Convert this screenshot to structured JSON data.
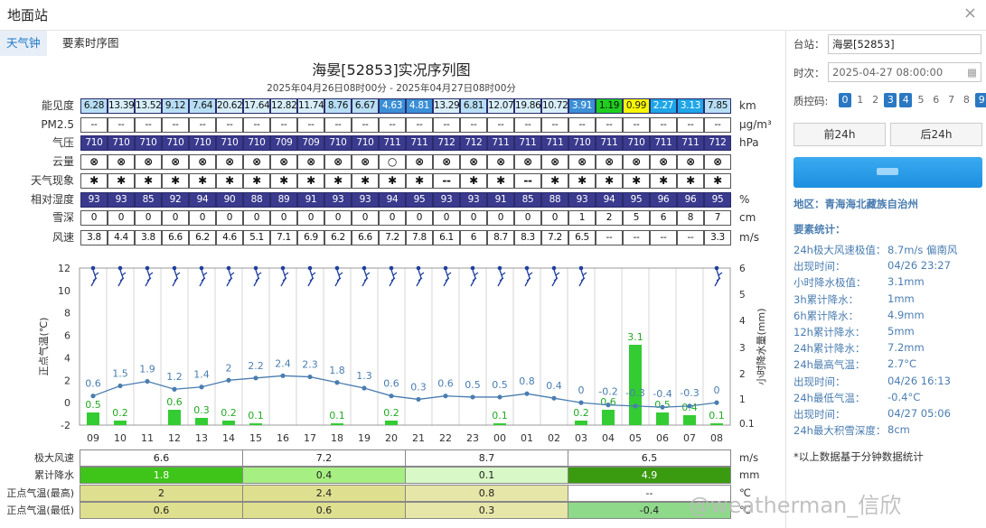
{
  "window": {
    "title": "地面站",
    "close": "×"
  },
  "tabs": [
    {
      "label": "天气钟",
      "active": true
    },
    {
      "label": "要素时序图",
      "active": false
    }
  ],
  "chart_title": "海晏[52853]实况序列图",
  "chart_subtitle": "2025年04月26日08时00分 - 2025年04月27日08时00分",
  "table": {
    "rows": [
      {
        "label": "能见度",
        "unit": "km",
        "type": "vis",
        "values": [
          "6.28",
          "13.39",
          "13.52",
          "9.12",
          "7.64",
          "20.62",
          "17.64",
          "12.82",
          "11.74",
          "8.76",
          "6.67",
          "4.63",
          "4.81",
          "13.29",
          "6.81",
          "12.07",
          "19.86",
          "10.72",
          "3.91",
          "1.19",
          "0.99",
          "2.27",
          "3.13",
          "7.85"
        ]
      },
      {
        "label": "PM2.5",
        "unit": "μg/m³",
        "type": "plain",
        "values": [
          "--",
          "--",
          "--",
          "--",
          "--",
          "--",
          "--",
          "--",
          "--",
          "--",
          "--",
          "--",
          "--",
          "--",
          "--",
          "--",
          "--",
          "--",
          "--",
          "--",
          "--",
          "--",
          "--",
          "--"
        ]
      },
      {
        "label": "气压",
        "unit": "hPa",
        "type": "dark",
        "values": [
          "710",
          "710",
          "710",
          "710",
          "710",
          "710",
          "710",
          "709",
          "709",
          "710",
          "710",
          "711",
          "711",
          "712",
          "712",
          "711",
          "711",
          "711",
          "710",
          "711",
          "710",
          "711",
          "711",
          "712"
        ]
      },
      {
        "label": "云量",
        "unit": "",
        "type": "wx",
        "values": [
          "⊗",
          "⊗",
          "⊗",
          "⊗",
          "⊗",
          "⊗",
          "⊗",
          "⊗",
          "⊗",
          "⊗",
          "⊗",
          "○",
          "⊗",
          "⊗",
          "⊗",
          "⊗",
          "⊗",
          "⊗",
          "⊗",
          "⊗",
          "⊗",
          "⊗",
          "⊗",
          "⊗"
        ]
      },
      {
        "label": "天气现象",
        "unit": "",
        "type": "wx",
        "values": [
          "✱",
          "✱",
          "✱",
          "✱",
          "✱",
          "✱",
          "✱",
          "✱",
          "✱",
          "✱",
          "✱",
          "✱",
          "✱",
          "--",
          "✱",
          "✱",
          "--",
          "✱",
          "✱",
          "✱",
          "✱",
          "✱",
          "✱",
          "✱"
        ]
      },
      {
        "label": "相对湿度",
        "unit": "%",
        "type": "dark",
        "values": [
          "93",
          "93",
          "85",
          "92",
          "94",
          "90",
          "88",
          "89",
          "91",
          "93",
          "93",
          "94",
          "95",
          "93",
          "93",
          "91",
          "85",
          "88",
          "93",
          "94",
          "95",
          "96",
          "96",
          "95"
        ]
      },
      {
        "label": "雪深",
        "unit": "cm",
        "type": "plain",
        "values": [
          "0",
          "0",
          "0",
          "0",
          "0",
          "0",
          "0",
          "0",
          "0",
          "0",
          "0",
          "0",
          "0",
          "0",
          "0",
          "0",
          "0",
          "0",
          "1",
          "2",
          "5",
          "6",
          "8",
          "7"
        ]
      },
      {
        "label": "风速",
        "unit": "m/s",
        "type": "plain",
        "values": [
          "3.8",
          "4.4",
          "3.8",
          "6.6",
          "6.2",
          "4.6",
          "5.1",
          "7.1",
          "6.9",
          "6.2",
          "6.6",
          "7.2",
          "7.8",
          "6.1",
          "6",
          "8.7",
          "8.3",
          "7.2",
          "6.5",
          "--",
          "--",
          "--",
          "--",
          "3.3"
        ]
      }
    ]
  },
  "chart_data": {
    "type": "line",
    "x": [
      "09",
      "10",
      "11",
      "12",
      "13",
      "14",
      "15",
      "16",
      "17",
      "18",
      "19",
      "20",
      "21",
      "22",
      "23",
      "00",
      "01",
      "02",
      "03",
      "04",
      "05",
      "06",
      "07",
      "08"
    ],
    "ylabel": "正点气温(℃)",
    "y2label": "小时降水量(mm)",
    "ylim": [
      -2,
      12
    ],
    "y2_ticks": [
      "0.1",
      "1",
      "2",
      "3",
      "4",
      "5",
      "6"
    ],
    "series": [
      {
        "type": "line",
        "values": [
          0.6,
          1.5,
          1.9,
          1.2,
          1.4,
          2,
          2.2,
          2.4,
          2.3,
          1.8,
          1.3,
          0.6,
          0.3,
          0.6,
          0.5,
          0.5,
          0.8,
          0.4,
          0,
          -0.2,
          -0.3,
          -0.4,
          -0.3,
          0
        ],
        "color": "#4a7db0"
      },
      {
        "type": "bar",
        "values": [
          0.5,
          0.2,
          null,
          0.6,
          0.3,
          0.2,
          0.1,
          null,
          null,
          0.1,
          null,
          0.2,
          null,
          null,
          null,
          0.1,
          null,
          null,
          0.2,
          0.6,
          3.1,
          0.5,
          0.4,
          0.1
        ],
        "color": "#33cc33"
      }
    ],
    "wind_present": [
      true,
      true,
      true,
      true,
      true,
      true,
      true,
      true,
      true,
      true,
      true,
      true,
      true,
      true,
      true,
      true,
      true,
      true,
      true,
      false,
      false,
      false,
      false,
      true
    ]
  },
  "bottom": {
    "rows": [
      {
        "label": "极大风速",
        "unit": "m/s",
        "values": [
          "6.6",
          "7.2",
          "8.7",
          "6.5"
        ],
        "colors": [
          "#fff",
          "#fff",
          "#fff",
          "#fff"
        ]
      },
      {
        "label": "累计降水",
        "unit": "mm",
        "values": [
          "1.8",
          "0.4",
          "0.1",
          "4.9"
        ],
        "colors": [
          "#3fc41a",
          "#a6ef82",
          "#d8f8c8",
          "#3a9b10"
        ]
      },
      {
        "label": "正点气温(最高)",
        "unit": "℃",
        "values": [
          "2",
          "2.4",
          "0.8",
          "--"
        ],
        "colors": [
          "#dfe08f",
          "#dfe08f",
          "#e6e6a8",
          "#fff"
        ]
      },
      {
        "label": "正点气温(最低)",
        "unit": "℃",
        "values": [
          "0.6",
          "0.6",
          "0.3",
          "-0.4"
        ],
        "colors": [
          "#dfe08f",
          "#dfe08f",
          "#e6e6a8",
          "#8ed98a"
        ]
      }
    ]
  },
  "side": {
    "station_label": "台站：",
    "station_value": "海晏[52853]",
    "time_label": "时次：",
    "time_value": "2025-04-27 08:00:00",
    "qc_label": "质控码:",
    "qc": [
      {
        "n": "0",
        "on": true
      },
      {
        "n": "1",
        "on": false
      },
      {
        "n": "2",
        "on": false
      },
      {
        "n": "3",
        "on": true
      },
      {
        "n": "4",
        "on": true
      },
      {
        "n": "5",
        "on": false
      },
      {
        "n": "6",
        "on": false
      },
      {
        "n": "7",
        "on": false
      },
      {
        "n": "8",
        "on": false
      },
      {
        "n": "9",
        "on": true
      }
    ],
    "prev_btn": "前24h",
    "next_btn": "后24h",
    "region": "地区：青海海北藏族自治州",
    "stats_title": "要素统计：",
    "stats": [
      {
        "k": "24h极大风速极值：",
        "v": "8.7m/s 偏南风"
      },
      {
        "k": "出现时间：",
        "v": "04/26 23:27"
      },
      {
        "k": "小时降水极值：",
        "v": "3.1mm"
      },
      {
        "k": "3h累计降水：",
        "v": "1mm"
      },
      {
        "k": "6h累计降水：",
        "v": "4.9mm"
      },
      {
        "k": "12h累计降水：",
        "v": "5mm"
      },
      {
        "k": "24h累计降水：",
        "v": "7.2mm"
      },
      {
        "k": "24h最高气温：",
        "v": "2.7°C"
      },
      {
        "k": "出现时间：",
        "v": "04/26 16:13"
      },
      {
        "k": "24h最低气温：",
        "v": "-0.4°C"
      },
      {
        "k": "出现时间：",
        "v": "04/27 05:06"
      },
      {
        "k": "24h最大积雪深度：",
        "v": "8cm"
      }
    ],
    "note": "*以上数据基于分钟数据统计"
  },
  "watermark": "@weatherman_信欣",
  "colors": {
    "accent": "#1a77c9",
    "line": "#4a7db0",
    "bar": "#33cc33"
  }
}
